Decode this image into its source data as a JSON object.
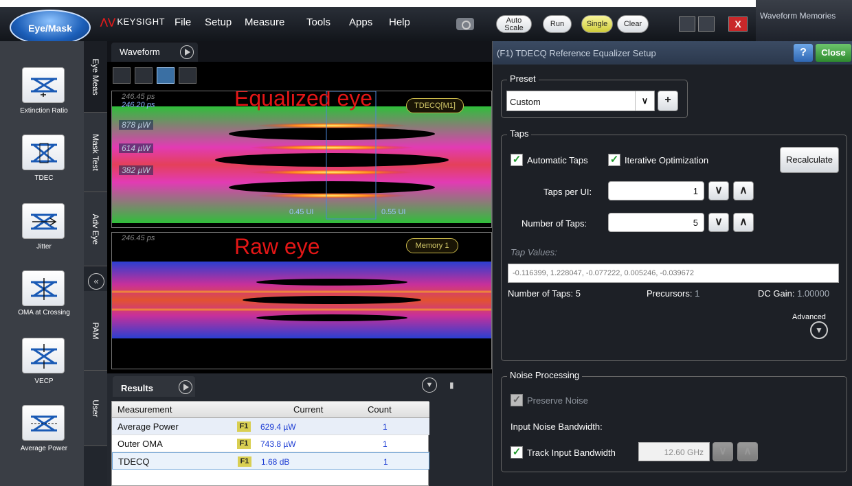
{
  "menubar": {
    "mode_button": "Eye/Mask",
    "brand": "KEYSIGHT",
    "menus": [
      "File",
      "Setup",
      "Measure",
      "Tools",
      "Apps",
      "Help"
    ],
    "auto_scale": "Auto Scale",
    "run": "Run",
    "single": "Single",
    "clear": "Clear",
    "close_glyph": "X",
    "waveform_memories": "Waveform Memories"
  },
  "sidebar": {
    "items": [
      {
        "label": "Extinction Ratio",
        "icon": "extinction-ratio-icon"
      },
      {
        "label": "TDEC",
        "icon": "tdec-icon"
      },
      {
        "label": "Jitter",
        "icon": "jitter-icon"
      },
      {
        "label": "OMA at Crossing",
        "icon": "oma-crossing-icon"
      },
      {
        "label": "VECP",
        "icon": "vecp-icon"
      },
      {
        "label": "Average Power",
        "icon": "average-power-icon"
      }
    ],
    "vertical_tabs": [
      "Eye Meas",
      "Mask Test",
      "Adv Eye",
      "PAM",
      "User"
    ],
    "collapse_glyph": "«"
  },
  "waveform": {
    "tab_label": "Waveform",
    "eq_eye": {
      "annotation": "Equalized eye",
      "readout_gray": "246.45 ps",
      "readout_blue": "246.20 ps",
      "levels": [
        "878 µW",
        "614 µW",
        "382 µW"
      ],
      "tag": "TDECQ[M1]",
      "ui_left": "0.45 UI",
      "ui_right": "0.55 UI"
    },
    "raw_eye": {
      "annotation": "Raw eye",
      "readout_gray": "246.45 ps",
      "tag": "Memory 1"
    }
  },
  "results": {
    "tab_label": "Results",
    "columns": [
      "Measurement",
      "Current",
      "Count"
    ],
    "rows": [
      {
        "name": "Average Power",
        "source": "F1",
        "current": "629.4 µW",
        "count": "1"
      },
      {
        "name": "Outer OMA",
        "source": "F1",
        "current": "743.8 µW",
        "count": "1"
      },
      {
        "name": "TDECQ",
        "source": "F1",
        "current": "1.68 dB",
        "count": "1"
      }
    ]
  },
  "dialog": {
    "title": "(F1) TDECQ Reference Equalizer Setup",
    "help": "?",
    "close": "Close",
    "preset": {
      "group": "Preset",
      "value": "Custom"
    },
    "taps": {
      "group": "Taps",
      "automatic_taps": "Automatic Taps",
      "iterative_optimization": "Iterative Optimization",
      "recalculate": "Recalculate",
      "taps_per_ui_label": "Taps per UI:",
      "taps_per_ui_value": "1",
      "number_of_taps_label": "Number of Taps:",
      "number_of_taps_value": "5",
      "tap_values_label": "Tap Values:",
      "tap_values": "-0.116399, 1.228047, -0.077222, 0.005246, -0.039672",
      "summary_taps_label": "Number of Taps:",
      "summary_taps_value": "5",
      "precursors_label": "Precursors:",
      "precursors_value": "1",
      "dc_gain_label": "DC Gain:",
      "dc_gain_value": "1.00000",
      "advanced": "Advanced"
    },
    "noise": {
      "group": "Noise Processing",
      "preserve_noise": "Preserve Noise",
      "input_noise_bw_label": "Input Noise Bandwidth:",
      "track_input_bw": "Track Input Bandwidth",
      "bandwidth_value": "12.60 GHz"
    }
  },
  "colors": {
    "eye_annotation": "#e31616",
    "accent_blue": "#1b3bd3",
    "check_green": "#1f9a2c",
    "close_green": "#2e8a2e"
  }
}
